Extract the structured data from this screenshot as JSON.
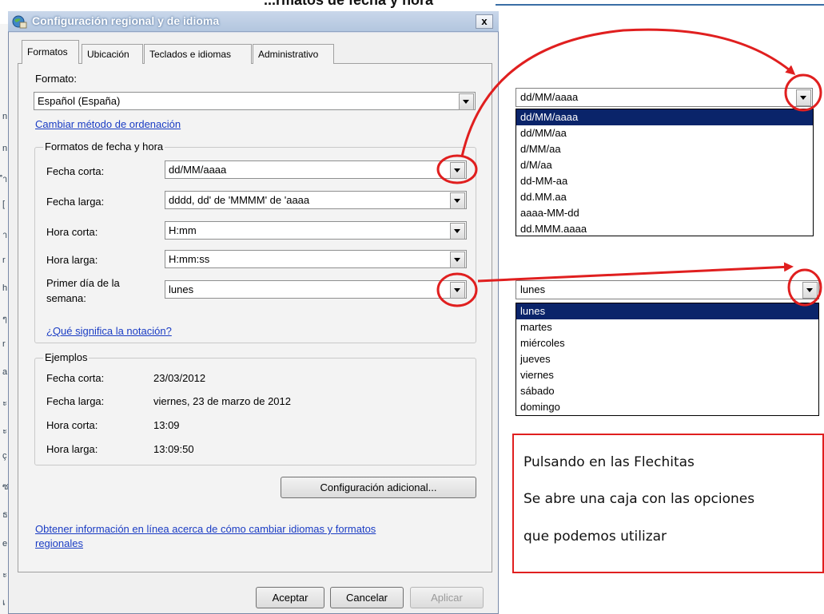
{
  "page": {
    "cropped_title": "...rmatos de fecha y hora"
  },
  "left_strip": [
    "n",
    "n",
    "ำ",
    "[",
    "า",
    "r",
    "h",
    "ๆ",
    "r",
    "a",
    "ะ",
    "ะ",
    "ç",
    "ซ",
    "ธ",
    "e",
    "ะ",
    "เ"
  ],
  "window": {
    "title": "Configuración regional y de idioma",
    "close_glyph": "x"
  },
  "tabs": [
    "Formatos",
    "Ubicación",
    "Teclados e idiomas",
    "Administrativo"
  ],
  "format": {
    "label": "Formato:",
    "value": "Español (España)",
    "sort_link": "Cambiar método de ordenación"
  },
  "datetime_group": {
    "title": "Formatos de fecha y hora",
    "rows": [
      {
        "label": "Fecha corta:",
        "value": "dd/MM/aaaa"
      },
      {
        "label": "Fecha larga:",
        "value": "dddd, dd' de 'MMMM' de 'aaaa"
      },
      {
        "label": "Hora corta:",
        "value": "H:mm"
      },
      {
        "label": "Hora larga:",
        "value": "H:mm:ss"
      }
    ],
    "first_day": {
      "label_line1": "Primer día de la",
      "label_line2": "semana:",
      "value": "lunes"
    },
    "notation_link": "¿Qué significa la notación?"
  },
  "examples": {
    "title": "Ejemplos",
    "rows": [
      {
        "label": "Fecha corta:",
        "value": "23/03/2012"
      },
      {
        "label": "Fecha larga:",
        "value": "viernes, 23 de marzo de 2012"
      },
      {
        "label": "Hora corta:",
        "value": "13:09"
      },
      {
        "label": "Hora larga:",
        "value": "13:09:50"
      }
    ]
  },
  "additional_button": "Configuración adicional...",
  "online_link": {
    "line1": "Obtener información en línea acerca de cómo cambiar idiomas y formatos",
    "line2": "regionales"
  },
  "footer": {
    "ok": "Aceptar",
    "cancel": "Cancelar",
    "apply": "Aplicar"
  },
  "date_dropdown": {
    "value": "dd/MM/aaaa",
    "options": [
      "dd/MM/aaaa",
      "dd/MM/aa",
      "d/MM/aa",
      "d/M/aa",
      "dd-MM-aa",
      "dd.MM.aa",
      "aaaa-MM-dd",
      "dd.MMM.aaaa"
    ]
  },
  "day_dropdown": {
    "value": "lunes",
    "options": [
      "lunes",
      "martes",
      "miércoles",
      "jueves",
      "viernes",
      "sábado",
      "domingo"
    ]
  },
  "note": {
    "line1": "Pulsando en las Flechitas",
    "line2": "Se abre una caja con las opciones",
    "line3": "que podemos utilizar"
  },
  "colors": {
    "annotation": "#e01f1f",
    "selection": "#0a246a",
    "link": "#1a3cc4"
  }
}
